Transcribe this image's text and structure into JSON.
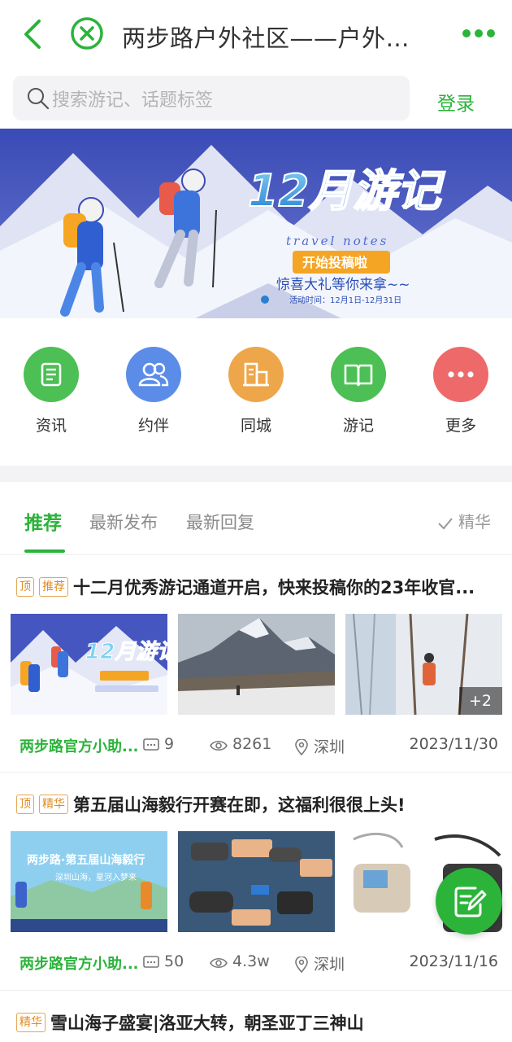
{
  "header": {
    "title": "两步路户外社区——户外助..."
  },
  "search": {
    "placeholder": "搜索游记、话题标签",
    "login_label": "登录"
  },
  "banner": {
    "title": "12月游记",
    "subtitle": "travel notes",
    "cta": "开始投稿啦",
    "tagline": "惊喜大礼等你来拿~~",
    "period": "活动时间：12月1日-12月31日"
  },
  "quick_nav": [
    {
      "label": "资讯",
      "color": "#4cbf55",
      "icon": "news-icon"
    },
    {
      "label": "约伴",
      "color": "#5b8de8",
      "icon": "companions-icon"
    },
    {
      "label": "同城",
      "color": "#eea64a",
      "icon": "city-icon"
    },
    {
      "label": "游记",
      "color": "#4cbf55",
      "icon": "book-icon"
    },
    {
      "label": "更多",
      "color": "#ee6a6a",
      "icon": "more-icon"
    }
  ],
  "tabs": {
    "items": [
      "推荐",
      "最新发布",
      "最新回复"
    ],
    "active": "推荐",
    "filter_label": "精华"
  },
  "posts": [
    {
      "tags": [
        "顶",
        "推荐"
      ],
      "title": "十二月优秀游记通道开启，快来投稿你的23年收官...",
      "author": "两步路官方小助...",
      "comments": "9",
      "views": "8261",
      "location": "深圳",
      "date": "2023/11/30",
      "more_images": "+2"
    },
    {
      "tags": [
        "顶",
        "精华"
      ],
      "title": "第五届山海毅行开赛在即，这福利很很上头!",
      "author": "两步路官方小助...",
      "comments": "50",
      "views": "4.3w",
      "location": "深圳",
      "date": "2023/11/16",
      "image_text": "两步路·第五届山海毅行",
      "image_sub": "深圳山海，星河入梦来"
    },
    {
      "tags": [
        "精华"
      ],
      "title": "雪山海子盛宴|洛亚大转，朝圣亚丁三神山"
    }
  ],
  "colors": {
    "brand_green": "#2bb33a",
    "tag_orange": "#e08a1e"
  }
}
